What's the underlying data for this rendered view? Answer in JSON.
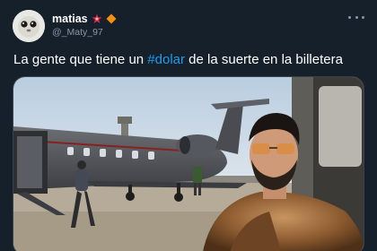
{
  "tweet": {
    "author": {
      "display_name": "matias",
      "handle": "@_Maty_97",
      "badges": [
        "red-star-emoji",
        "orange-diamond-emoji"
      ]
    },
    "text_before": "La gente que tiene un ",
    "hashtag": "#dolar",
    "text_after": " de la suerte en la billetera",
    "media": {
      "alt": "photo-man-fur-coat-sunglasses-private-jet"
    }
  },
  "colors": {
    "background": "#15202b",
    "text": "#ffffff",
    "secondary": "#8b98a5",
    "link": "#1d9bf0",
    "border": "#38444d"
  }
}
